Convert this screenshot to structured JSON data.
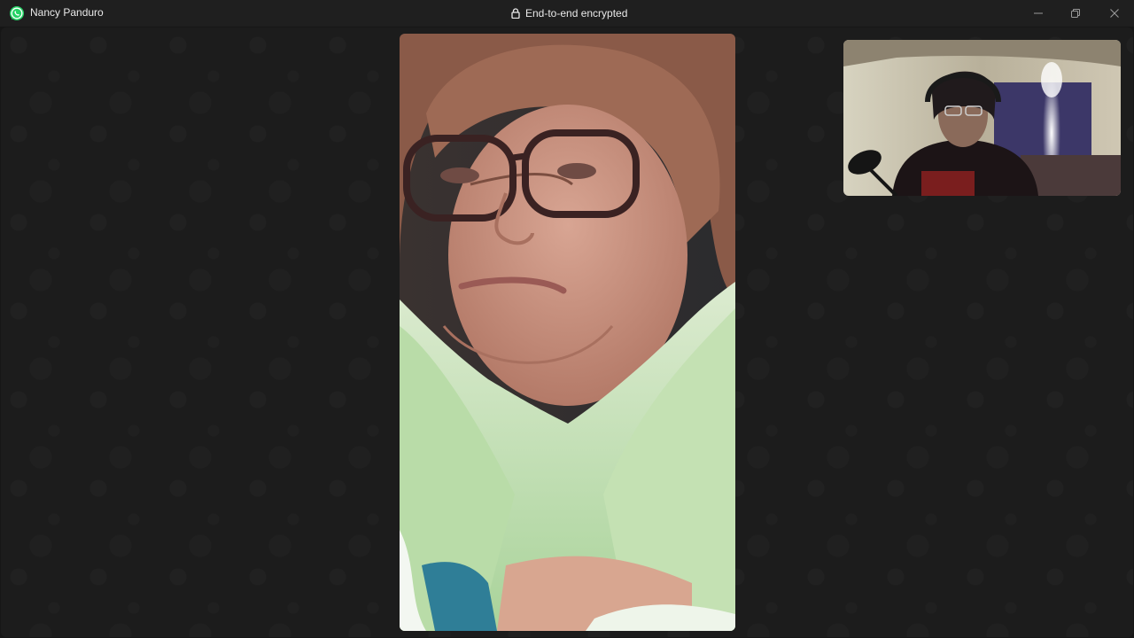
{
  "titlebar": {
    "contact_name": "Nancy Panduro",
    "encryption_label": "End-to-end encrypted",
    "app_icon": "whatsapp-logo-icon",
    "lock_icon": "lock-icon",
    "controls": {
      "minimize_icon": "minimize-icon",
      "restore_icon": "restore-icon",
      "close_icon": "close-icon"
    }
  },
  "call": {
    "remote_video": "remote participant video feed",
    "self_video": "self preview video feed"
  },
  "colors": {
    "titlebar_bg": "#1f1f1f",
    "call_bg": "#1c1c1c",
    "brand_green": "#25d366",
    "text": "#e9e9e9"
  }
}
